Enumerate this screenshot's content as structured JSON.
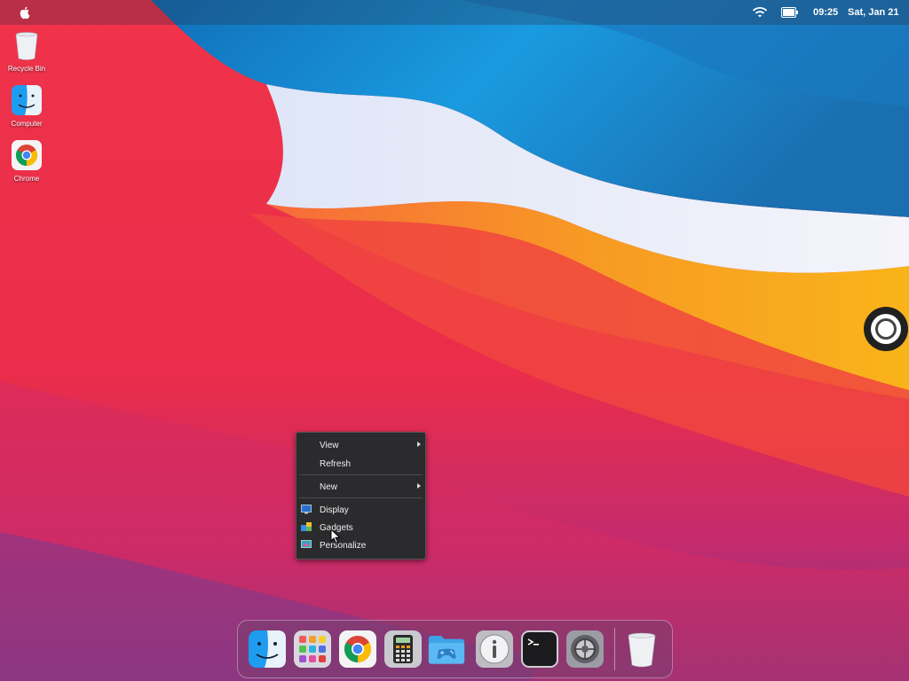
{
  "menubar": {
    "time": "09:25",
    "date": "Sat, Jan 21",
    "icons": [
      "apple-icon",
      "wifi-icon",
      "battery-icon"
    ]
  },
  "desktop_icons": [
    {
      "label": "Recycle Bin",
      "icon": "recycle-bin-icon"
    },
    {
      "label": "Computer",
      "icon": "finder-icon"
    },
    {
      "label": "Chrome",
      "icon": "chrome-icon"
    }
  ],
  "context_menu": {
    "items": [
      {
        "label": "View",
        "submenu": true
      },
      {
        "label": "Refresh",
        "submenu": false
      },
      {
        "label": "New",
        "submenu": true
      },
      {
        "label": "Display",
        "icon": "display-icon"
      },
      {
        "label": "Gadgets",
        "icon": "gadgets-icon"
      },
      {
        "label": "Personalize",
        "icon": "personalize-icon"
      }
    ]
  },
  "dock": {
    "apps": [
      "finder-icon",
      "launchpad-icon",
      "chrome-icon",
      "calculator-icon",
      "games-folder-icon",
      "info-icon",
      "terminal-icon",
      "settings-icon",
      "trash-icon"
    ]
  },
  "colors": {
    "context_menu_bg": "#2b2b2e",
    "wallpaper_red": "#e8283f",
    "wallpaper_blue": "#1a8fd6",
    "wallpaper_orange": "#f7a21b"
  }
}
